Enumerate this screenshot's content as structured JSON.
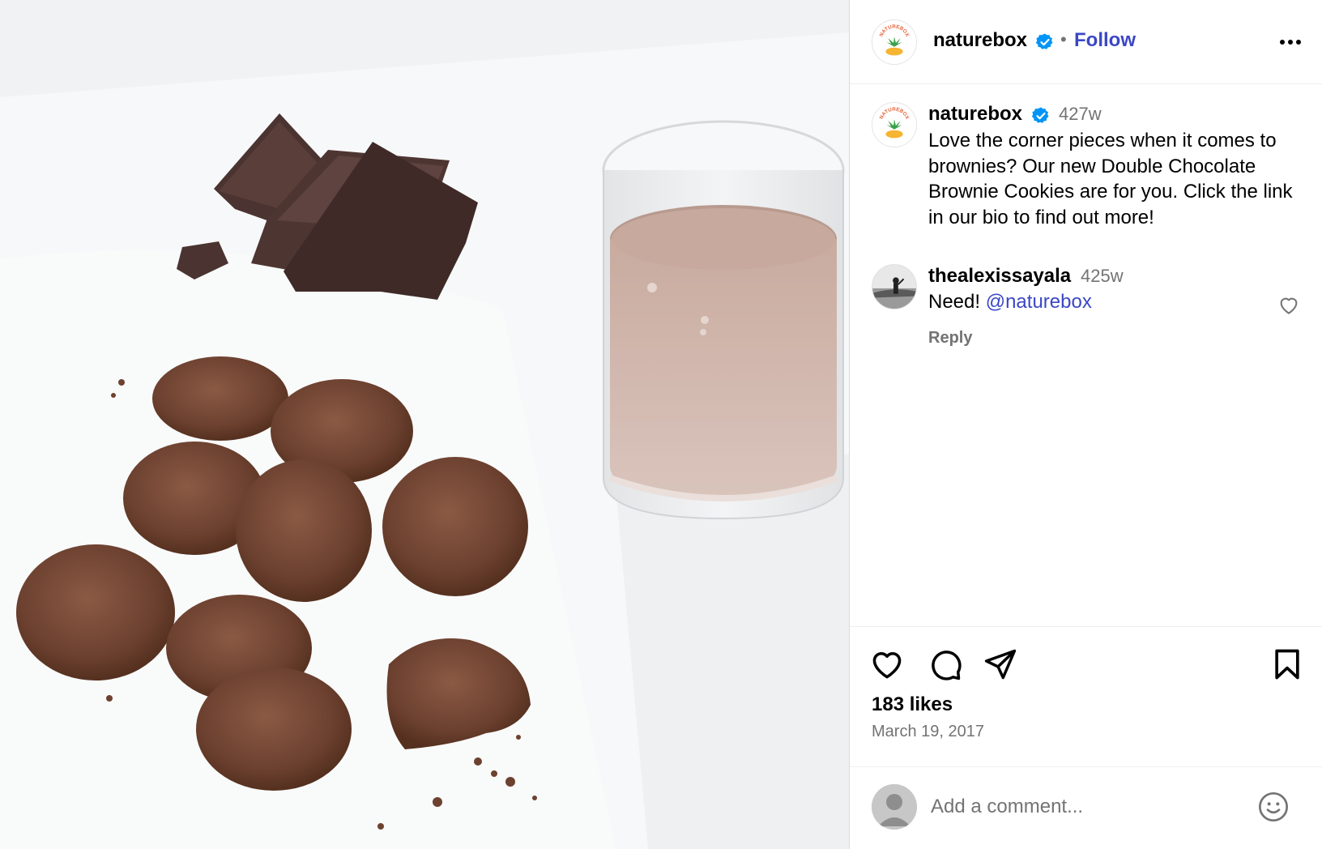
{
  "post": {
    "username": "naturebox",
    "follow_label": "Follow",
    "separator": "•",
    "caption": {
      "username": "naturebox",
      "time": "427w",
      "text": "Love the corner pieces when it comes to brownies? Our new Double Chocolate Brownie Cookies are for you. Click the link in our bio to find out more!"
    },
    "comments": [
      {
        "username": "thealexissayala",
        "time": "425w",
        "text": "Need!",
        "mention": "@naturebox",
        "reply_label": "Reply"
      }
    ],
    "likes": "183 likes",
    "date": "March 19, 2017",
    "comment_placeholder": "Add a comment..."
  },
  "logo": {
    "arc_text": "NATUREBOX"
  },
  "icons": {
    "verified": "verified-badge-icon",
    "more": "more-options-icon",
    "like": "heart-icon",
    "comment": "comment-bubble-icon",
    "share": "paper-plane-icon",
    "save": "bookmark-icon",
    "emoji": "emoji-icon"
  },
  "colors": {
    "link": "#3b47c5",
    "verified": "#0095f6",
    "muted": "#737373",
    "border": "#efefef"
  }
}
